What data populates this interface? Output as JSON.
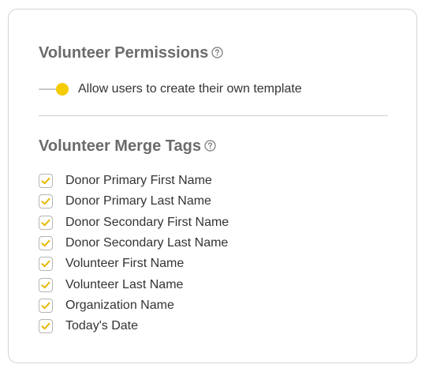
{
  "permissions": {
    "title": "Volunteer Permissions",
    "help_icon": "question-circle-icon",
    "toggle": {
      "label": "Allow users to create their own template",
      "on": true,
      "color": "#f5cc00"
    }
  },
  "merge_tags": {
    "title": "Volunteer Merge Tags",
    "help_icon": "question-circle-icon",
    "check_color": "#e6b800",
    "items": [
      {
        "label": "Donor Primary First Name",
        "checked": true
      },
      {
        "label": "Donor Primary Last Name",
        "checked": true
      },
      {
        "label": "Donor Secondary First Name",
        "checked": true
      },
      {
        "label": "Donor Secondary Last Name",
        "checked": true
      },
      {
        "label": "Volunteer First Name",
        "checked": true
      },
      {
        "label": "Volunteer Last Name",
        "checked": true
      },
      {
        "label": "Organization Name",
        "checked": true
      },
      {
        "label": "Today's Date",
        "checked": true
      }
    ]
  }
}
